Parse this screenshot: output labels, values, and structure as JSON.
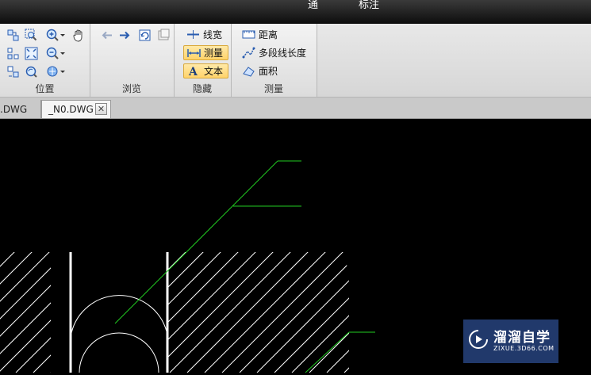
{
  "window": {
    "title_fragments": [
      "通",
      "标注"
    ]
  },
  "ribbon": {
    "groups": [
      {
        "id": "position",
        "label": "位置"
      },
      {
        "id": "browse",
        "label": "浏览"
      },
      {
        "id": "hide",
        "label": "隐藏"
      },
      {
        "id": "measure",
        "label": "测量"
      }
    ],
    "position_tools": [
      "pan-window-icon",
      "zoom-window-icon",
      "zoom-in-dropdown-icon",
      "hand-pan-icon",
      "zoom-extents-icon",
      "fit-window-icon",
      "zoom-out-dropdown-icon",
      "zoom-previous-icon",
      "zoom-realtime-icon",
      "view-3d-dropdown-icon"
    ],
    "browse_tools": [
      "back-arrow-icon",
      "forward-arrow-icon",
      "rotate-icon",
      "reset-view-icon"
    ],
    "hide": {
      "lineweight_label": "线宽",
      "measure_label": "测量",
      "text_label": "文本"
    },
    "measure": {
      "distance_label": "距离",
      "polyline_length_label": "多段线长度",
      "area_label": "面积"
    }
  },
  "tabs": [
    {
      "label": ".DWG",
      "active": false
    },
    {
      "label": "_N0.DWG",
      "active": true
    }
  ],
  "tab_close_symbol": "✕",
  "watermark": {
    "name": "溜溜自学",
    "url": "ZIXUE.3D66.COM"
  },
  "colors": {
    "canvas_bg": "#000000",
    "hatch_line": "#ffffff",
    "leader_line": "#22cc22",
    "active_button": "#ffd36a",
    "watermark_bg": "#284682"
  }
}
